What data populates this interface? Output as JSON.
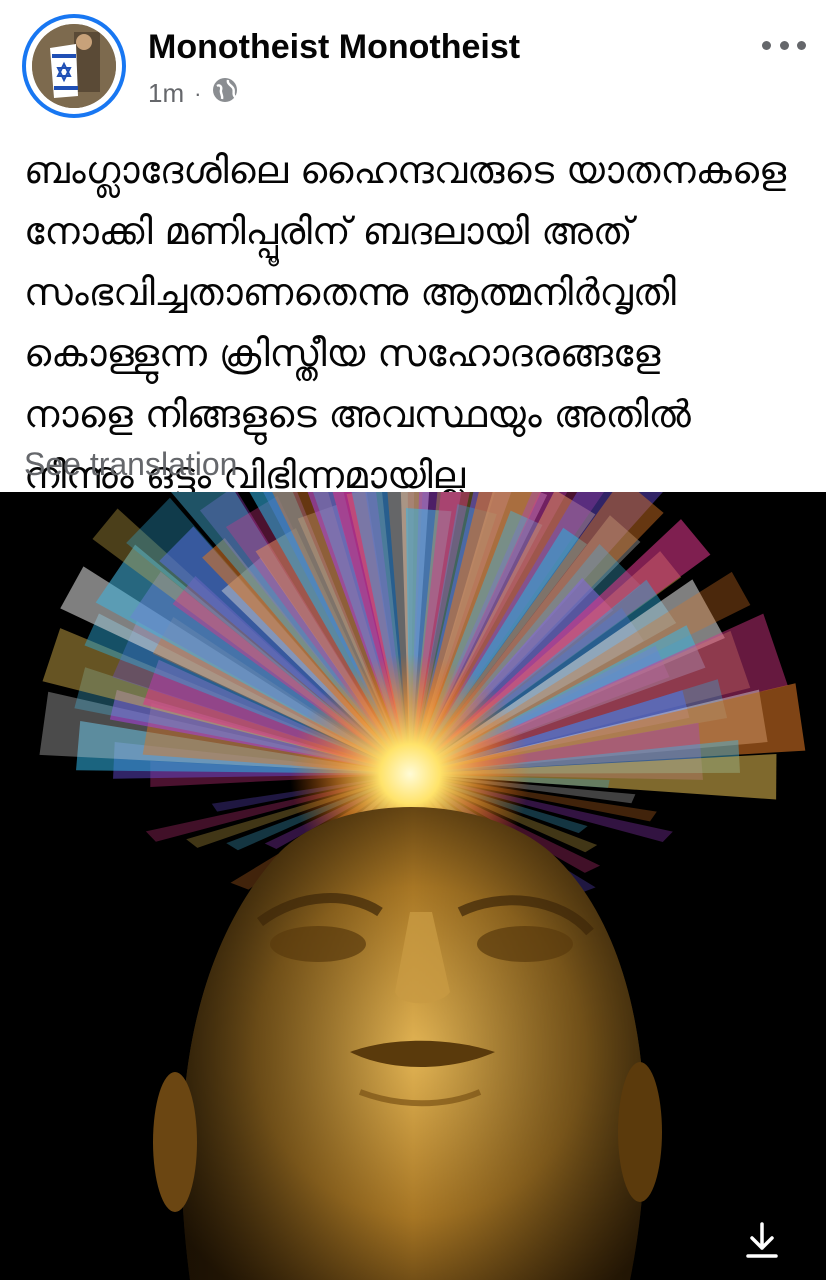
{
  "post": {
    "author": "Monotheist Monotheist",
    "time": "1m",
    "separator": "·",
    "privacy_icon": "globe-icon",
    "more_icon": "more-horizontal-icon",
    "text_lines": [
      "ബംഗ്ലാദേശിലെ ഹൈന്ദവരുടെ യാതനകളെ",
      "നോക്കി മണിപ്പൂരിന് ബദലായി അത്",
      "സംഭവിച്ചതാണതെന്നു ആത്മനിർവൃതി",
      "കൊള്ളുന്ന ക്രിസ്തീയ സഹോദരങ്ങളേ",
      "നാളെ നിങ്ങളുടെ അവസ്ഥയും അതിൽ",
      "നിന്നും ഒട്ടും വിഭിന്നമായില്ല"
    ],
    "see_translation": "See translation",
    "download_icon": "download-icon"
  },
  "colors": {
    "accent": "#1877f2",
    "text_primary": "#050505",
    "text_secondary": "#65676b",
    "photo_background": "#000000"
  }
}
